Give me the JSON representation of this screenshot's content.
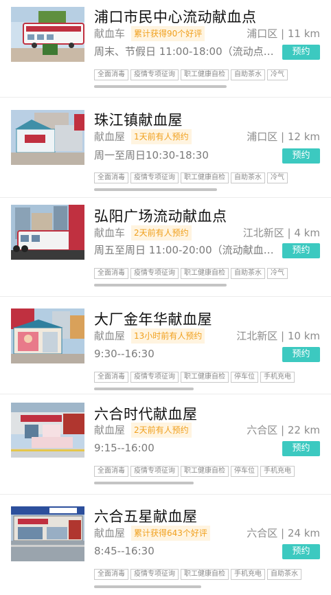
{
  "book_label": "预约",
  "sites": [
    {
      "title": "浦口市民中心流动献血点",
      "kind": "献血车",
      "badge": "累计获得90个好评",
      "district": "浦口区",
      "distance": "11 km",
      "hours": "周末、节假日 11:00-18:00（流动点…",
      "tags": [
        "全面消毒",
        "疫情专项征询",
        "职工健康自检",
        "自助茶水",
        "冷气"
      ],
      "image_icon": "blood-bus-photo"
    },
    {
      "title": "珠江镇献血屋",
      "kind": "献血屋",
      "badge": "1天前有人预约",
      "district": "浦口区",
      "distance": "12 km",
      "hours": "周一至周日10:30-18:30",
      "tags": [
        "全面消毒",
        "疫情专项征询",
        "职工健康自检",
        "自助茶水",
        "冷气"
      ],
      "image_icon": "blood-house-photo"
    },
    {
      "title": "弘阳广场流动献血点",
      "kind": "献血车",
      "badge": "2天前有人预约",
      "district": "江北新区",
      "distance": "4 km",
      "hours": "周五至周日 11:00-20:00（流动献血…",
      "tags": [
        "全面消毒",
        "疫情专项征询",
        "职工健康自检",
        "自助茶水",
        "冷气"
      ],
      "image_icon": "plaza-bus-photo"
    },
    {
      "title": "大厂金年华献血屋",
      "kind": "献血屋",
      "badge": "13小时前有人预约",
      "district": "江北新区",
      "distance": "10 km",
      "hours": "9:30--16:30",
      "tags": [
        "全面消毒",
        "疫情专项征询",
        "职工健康自检",
        "停车位",
        "手机充电"
      ],
      "image_icon": "blood-house-photo"
    },
    {
      "title": "六合时代献血屋",
      "kind": "献血屋",
      "badge": "2天前有人预约",
      "district": "六合区",
      "distance": "22 km",
      "hours": "9:15--16:00",
      "tags": [
        "全面消毒",
        "疫情专项征询",
        "职工健康自检",
        "停车位",
        "手机充电"
      ],
      "image_icon": "blood-house-photo"
    },
    {
      "title": "六合五星献血屋",
      "kind": "献血屋",
      "badge": "累计获得643个好评",
      "district": "六合区",
      "distance": "24 km",
      "hours": "8:45--16:30",
      "tags": [
        "全面消毒",
        "疫情专项征询",
        "职工健康自检",
        "手机充电",
        "自助茶水"
      ],
      "image_icon": "blood-house-photo"
    }
  ],
  "colors": {
    "accent": "#3cc9c0",
    "badge_text": "#f0a01e",
    "badge_bg": "#fff4e0"
  }
}
